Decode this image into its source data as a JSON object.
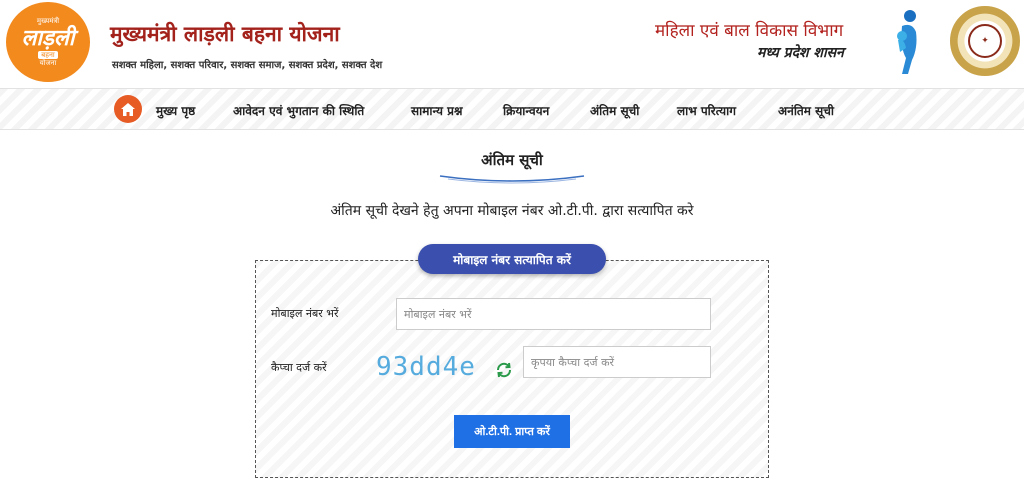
{
  "header": {
    "logo": {
      "line1": "मुख्यमंत्री",
      "line2": "लाड़ली",
      "line3": "बहना",
      "line4": "योजना"
    },
    "title": "मुख्यमंत्री लाड़ली बहना योजना",
    "tagline": "सशक्त महिला, सशक्त परिवार, सशक्त समाज, सशक्त प्रदेश, सशक्त देश",
    "department": "महिला एवं बाल विकास विभाग",
    "state": "मध्य प्रदेश शासन"
  },
  "nav": {
    "home_icon": "home-icon",
    "items": [
      "मुख्य पृष्ठ",
      "आवेदन एवं भुगतान की स्थिति",
      "सामान्य प्रश्न",
      "क्रियान्वयन",
      "अंतिम सूची",
      "लाभ परित्याग",
      "अनंतिम सूची"
    ]
  },
  "main": {
    "section_title": "अंतिम सूची",
    "instruction": "अंतिम सूची देखने हेतु अपना मोबाइल नंबर ओ.टी.पी. द्वारा सत्यापित करे",
    "form": {
      "badge": "मोबाइल नंबर सत्यापित करें",
      "mobile_label": "मोबाइल नंबर भरें",
      "mobile_placeholder": "मोबाइल नंबर भरें",
      "captcha_label": "कैप्चा दर्ज करें",
      "captcha_text": "93dd4e",
      "captcha_placeholder": "कृपया कैप्चा दर्ज करें",
      "submit_label": "ओ.टी.पी. प्राप्त करें"
    }
  },
  "colors": {
    "brand_orange": "#f28a1e",
    "title_red": "#a3221c",
    "badge_blue": "#3b4fae",
    "button_blue": "#1f6fe5",
    "home_orange": "#e75b25"
  }
}
